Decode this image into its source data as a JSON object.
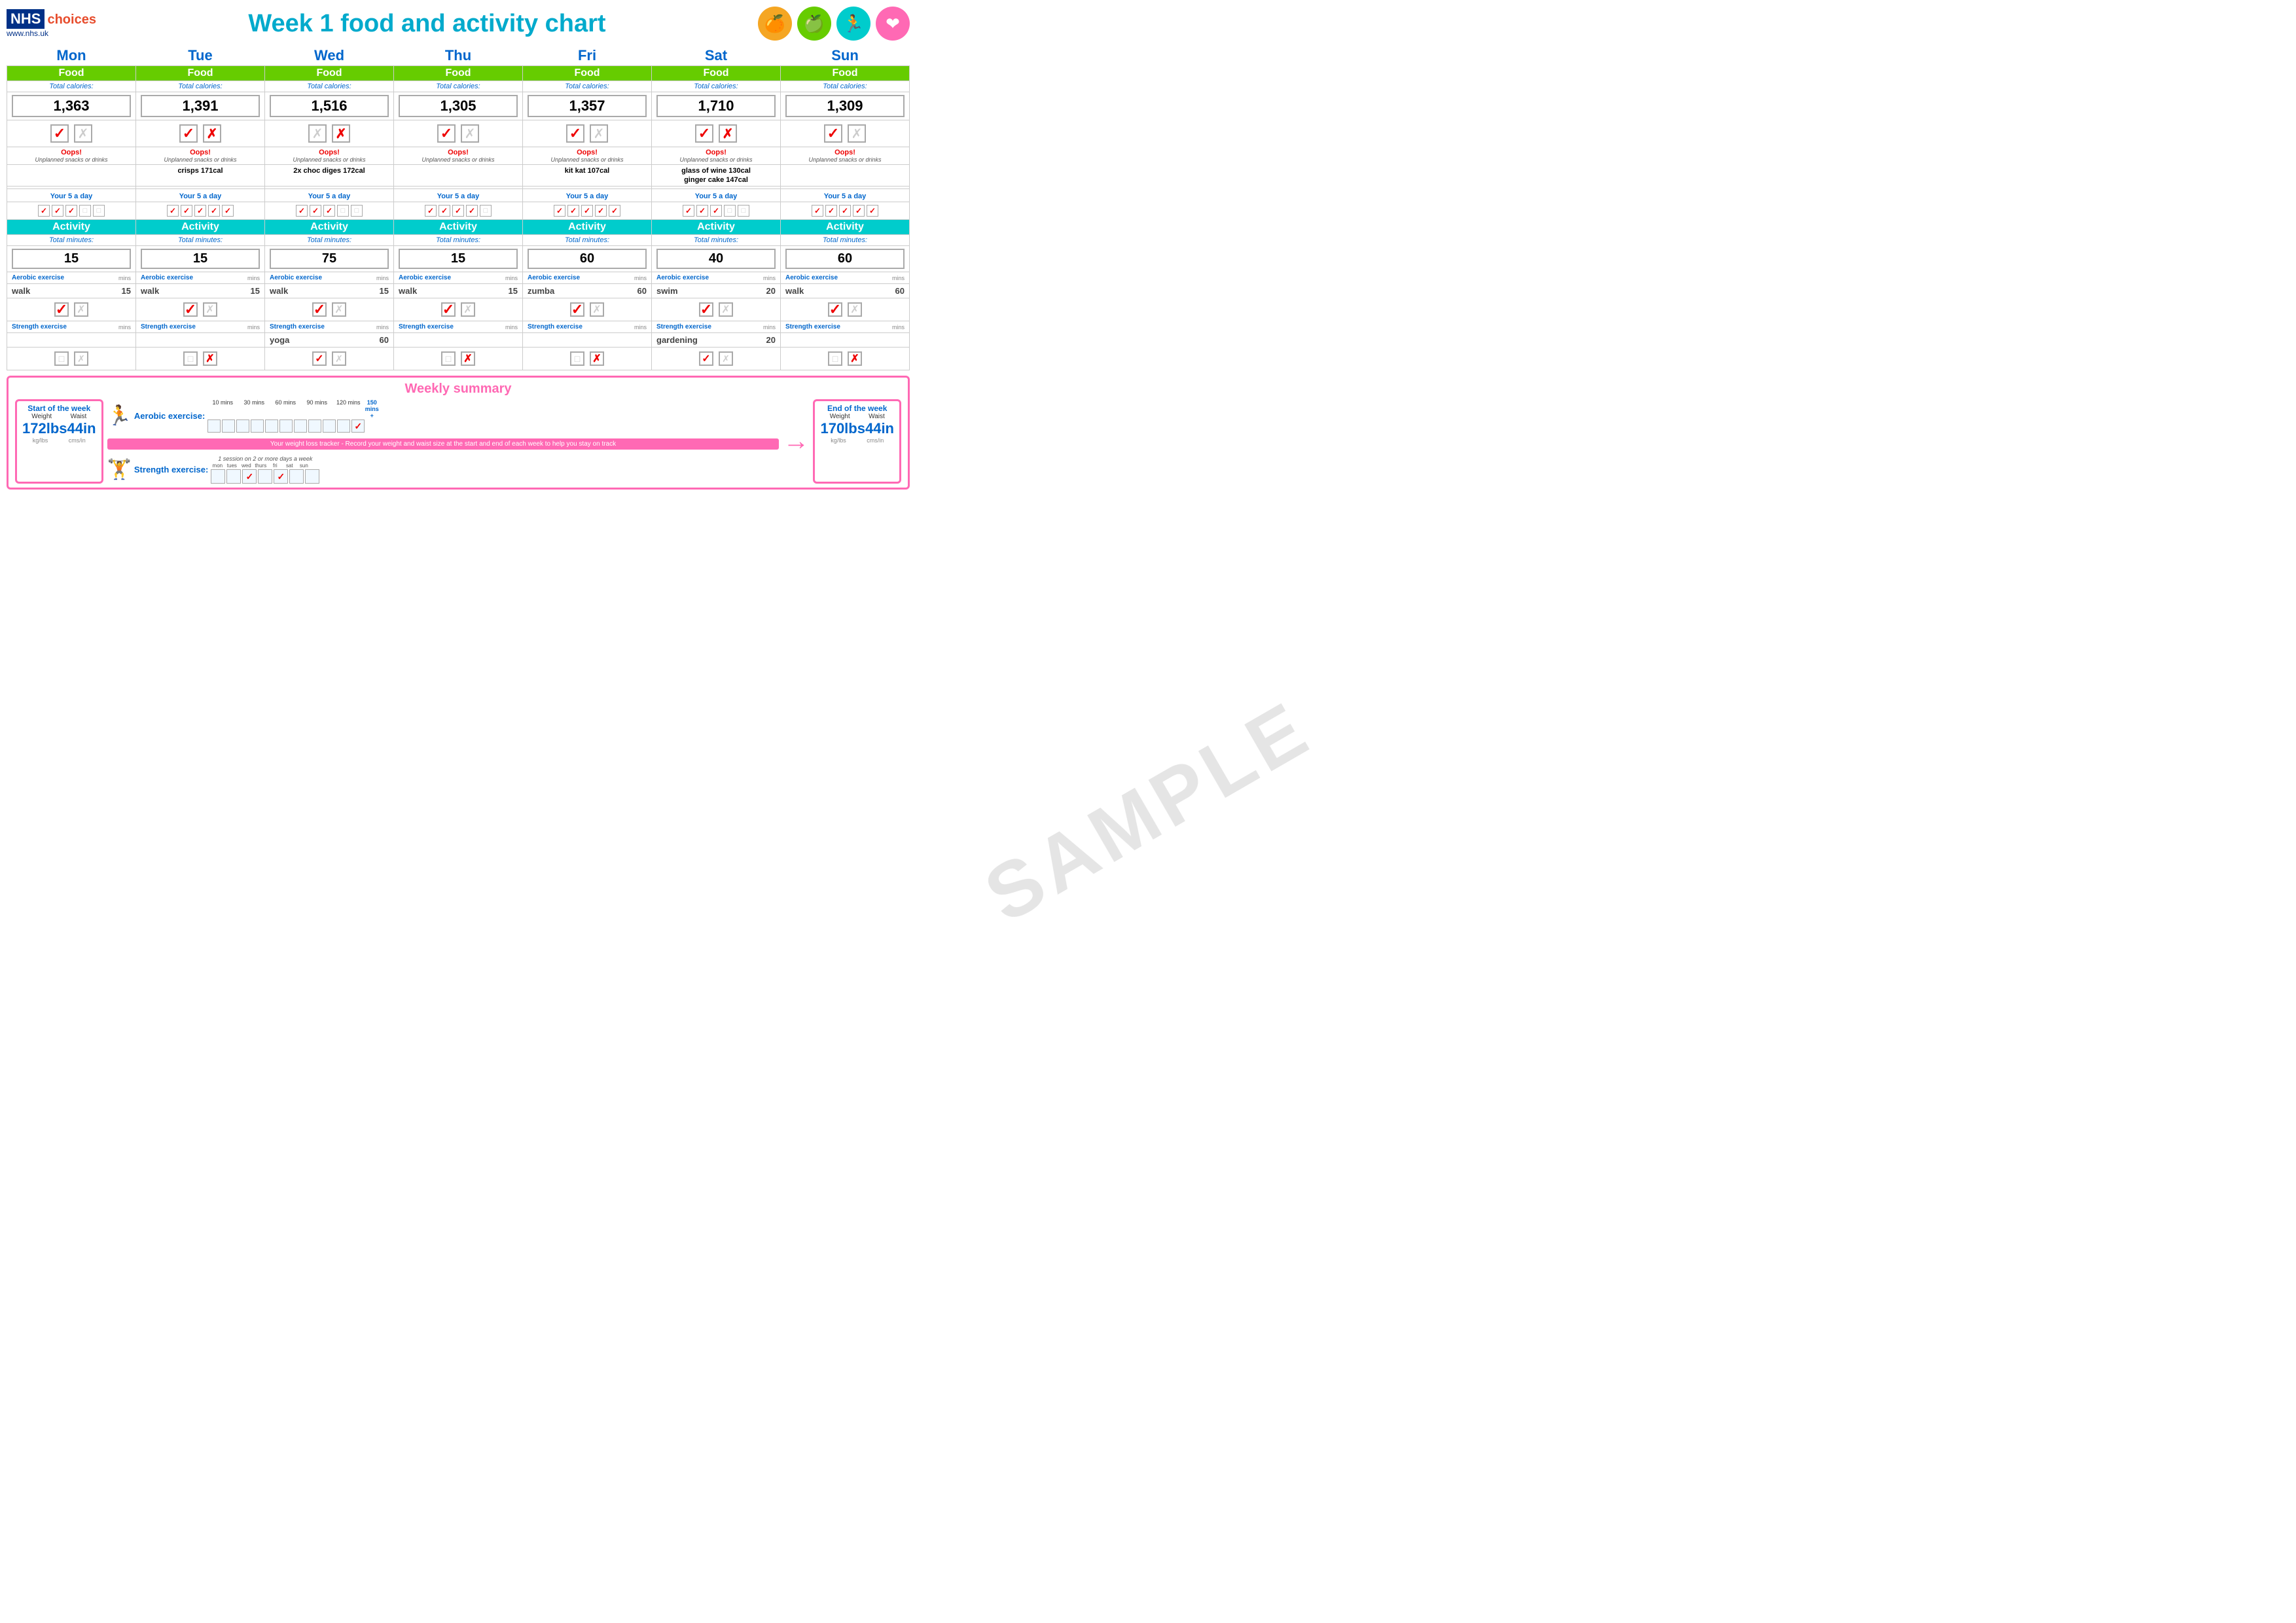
{
  "header": {
    "nhs": "NHS",
    "choices": "choices",
    "url": "www.nhs.uk",
    "title": "Week 1 food and activity chart",
    "icons": [
      {
        "name": "orange-circle",
        "color": "#f5a623",
        "symbol": "🍊"
      },
      {
        "name": "green-circle",
        "color": "#66cc00",
        "symbol": "🍏"
      },
      {
        "name": "teal-circle",
        "color": "#00cccc",
        "symbol": "🏃"
      },
      {
        "name": "pink-circle",
        "color": "#ff69b4",
        "symbol": "❤"
      }
    ]
  },
  "days": [
    "Mon",
    "Tue",
    "Wed",
    "Thu",
    "Fri",
    "Sat",
    "Sun"
  ],
  "food_header": "Food",
  "activity_header": "Activity",
  "food_total_label": "Total calories:",
  "activity_total_label": "Total minutes:",
  "oops_label": "Oops!",
  "unplanned_label": "Unplanned snacks or drinks",
  "aerobic_label": "Aerobic exercise",
  "strength_label": "Strength exercise",
  "mins_label": "mins",
  "five_a_day_label": "Your 5 a day",
  "columns": [
    {
      "day": "Mon",
      "calories": "1,363",
      "checked": true,
      "oops_checked": false,
      "snack": "",
      "five_a_day": [
        true,
        true,
        true,
        false,
        false
      ],
      "activity_mins": "15",
      "aerobic_exercise": "walk",
      "aerobic_mins": "15",
      "aerobic_check": true,
      "aerobic_x": false,
      "strength_exercise": "",
      "strength_mins": "",
      "strength_check": true,
      "strength_x": false,
      "bottom_check": false,
      "bottom_x": false
    },
    {
      "day": "Tue",
      "calories": "1,391",
      "checked": true,
      "oops_checked": true,
      "snack": "crisps 171cal",
      "five_a_day": [
        true,
        true,
        true,
        true,
        true
      ],
      "activity_mins": "15",
      "aerobic_exercise": "walk",
      "aerobic_mins": "15",
      "aerobic_check": true,
      "aerobic_x": false,
      "strength_exercise": "",
      "strength_mins": "",
      "strength_check": true,
      "strength_x": false,
      "bottom_check": false,
      "bottom_x": true
    },
    {
      "day": "Wed",
      "calories": "1,516",
      "checked": false,
      "oops_checked": true,
      "snack": "2x choc diges 172cal",
      "five_a_day": [
        true,
        true,
        true,
        false,
        false
      ],
      "activity_mins": "75",
      "aerobic_exercise": "walk",
      "aerobic_mins": "15",
      "aerobic_check": true,
      "aerobic_x": false,
      "strength_exercise": "yoga",
      "strength_mins": "60",
      "strength_check": true,
      "strength_x": false,
      "bottom_check": true,
      "bottom_x": false
    },
    {
      "day": "Thu",
      "calories": "1,305",
      "checked": true,
      "oops_checked": false,
      "snack": "",
      "five_a_day": [
        true,
        true,
        true,
        true,
        false
      ],
      "activity_mins": "15",
      "aerobic_exercise": "walk",
      "aerobic_mins": "15",
      "aerobic_check": true,
      "aerobic_x": false,
      "strength_exercise": "",
      "strength_mins": "",
      "strength_check": false,
      "strength_x": false,
      "bottom_check": false,
      "bottom_x": true
    },
    {
      "day": "Fri",
      "calories": "1,357",
      "checked": true,
      "oops_checked": false,
      "snack": "kit kat 107cal",
      "five_a_day": [
        true,
        true,
        true,
        true,
        true
      ],
      "activity_mins": "60",
      "aerobic_exercise": "zumba",
      "aerobic_mins": "60",
      "aerobic_check": true,
      "aerobic_x": false,
      "strength_exercise": "",
      "strength_mins": "",
      "strength_check": false,
      "strength_x": true,
      "bottom_check": false,
      "bottom_x": true
    },
    {
      "day": "Sat",
      "calories": "1,710",
      "checked": true,
      "oops_checked": true,
      "snack": "glass of wine 130cal",
      "snack2": "ginger cake  147cal",
      "five_a_day": [
        true,
        true,
        true,
        false,
        false
      ],
      "activity_mins": "40",
      "aerobic_exercise": "swim",
      "aerobic_mins": "20",
      "aerobic_check": true,
      "aerobic_x": false,
      "strength_exercise": "gardening",
      "strength_mins": "20",
      "strength_check": true,
      "strength_x": false,
      "bottom_check": true,
      "bottom_x": false
    },
    {
      "day": "Sun",
      "calories": "1,309",
      "checked": true,
      "oops_checked": false,
      "snack": "",
      "five_a_day": [
        true,
        true,
        true,
        true,
        true
      ],
      "activity_mins": "60",
      "aerobic_exercise": "walk",
      "aerobic_mins": "60",
      "aerobic_check": true,
      "aerobic_x": false,
      "strength_exercise": "",
      "strength_mins": "",
      "strength_check": false,
      "strength_x": false,
      "bottom_check": false,
      "bottom_x": true
    }
  ],
  "weekly_summary": {
    "title": "Weekly summary",
    "start_title": "Start of the week",
    "end_title": "End of the week",
    "weight_label": "Weight",
    "waist_label": "Waist",
    "start_weight": "172lbs",
    "start_waist": "44in",
    "end_weight": "170lbs",
    "end_waist": "44in",
    "kg_lbs": "kg/lbs",
    "cms_in": "cms/in",
    "aerobic_label": "Aerobic exercise:",
    "strength_label": "Strength exercise:",
    "tracker_text": "Your weight loss tracker - Record your weight and waist size at the start and end of each week to help you stay on track",
    "session_label": "1 session on 2 or more days a week",
    "aerobic_mins_labels": [
      "10 mins",
      "30 mins",
      "60 mins",
      "90 mins",
      "120 mins",
      "150 mins +"
    ],
    "aerobic_checks": [
      false,
      false,
      false,
      false,
      false,
      false,
      false,
      false,
      false,
      false,
      true
    ],
    "strength_days": [
      "mon",
      "tues",
      "wed",
      "thurs",
      "fri",
      "sat",
      "sun"
    ],
    "strength_day_checks": [
      false,
      false,
      true,
      false,
      true,
      false,
      false
    ]
  }
}
